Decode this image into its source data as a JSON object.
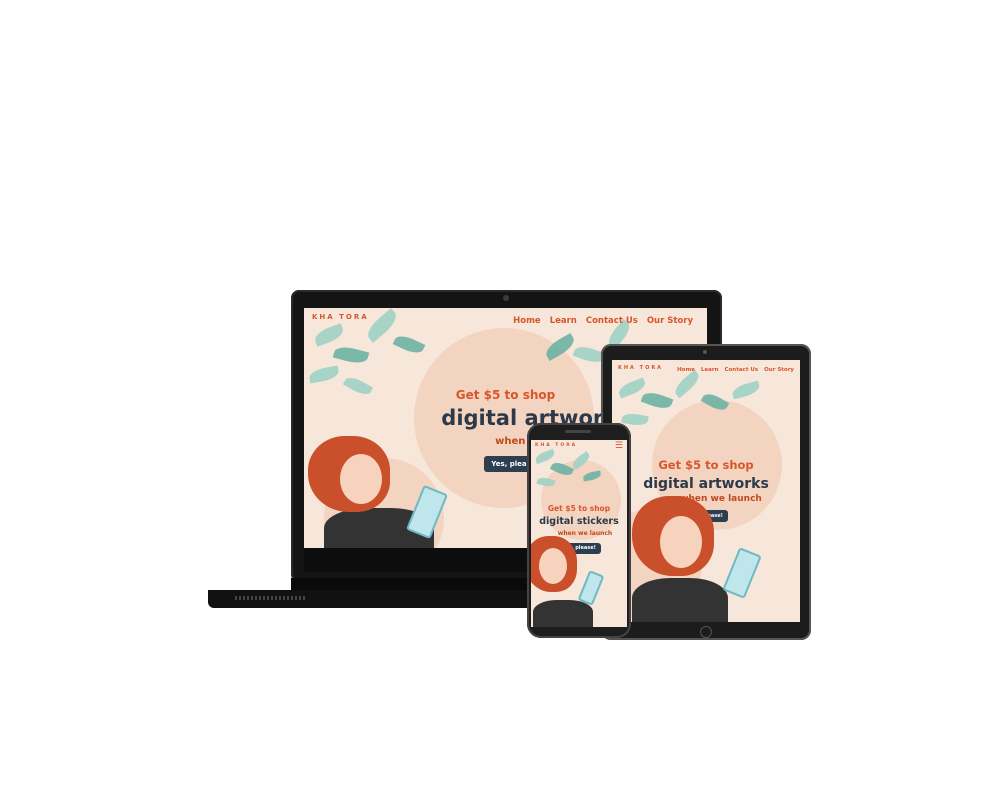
{
  "laptop": {
    "logo": "KHA TORA",
    "nav": [
      "Home",
      "Learn",
      "Contact Us",
      "Our Story"
    ],
    "headline_1": "Get $5 to shop",
    "headline_2": "digital artworks",
    "headline_3": "when we launch",
    "cta_label": "Yes, please!"
  },
  "tablet": {
    "nav": [
      "Home",
      "Learn",
      "Contact Us",
      "Our Story"
    ],
    "headline_1": "Get $5 to shop",
    "headline_2": "digital artworks",
    "headline_3": "when we launch",
    "cta_label": "Yes, please!"
  },
  "phone": {
    "menu_icon": "hamburger-menu-icon",
    "headline_1": "Get $5 to shop",
    "headline_2": "digital stickers",
    "headline_3": "when we launch",
    "cta_label": "Yes, please!"
  },
  "colors": {
    "accent": "#d9552c",
    "navy": "#2c3e50",
    "background": "#f7e6da",
    "leaf": "#9fd2c4"
  }
}
